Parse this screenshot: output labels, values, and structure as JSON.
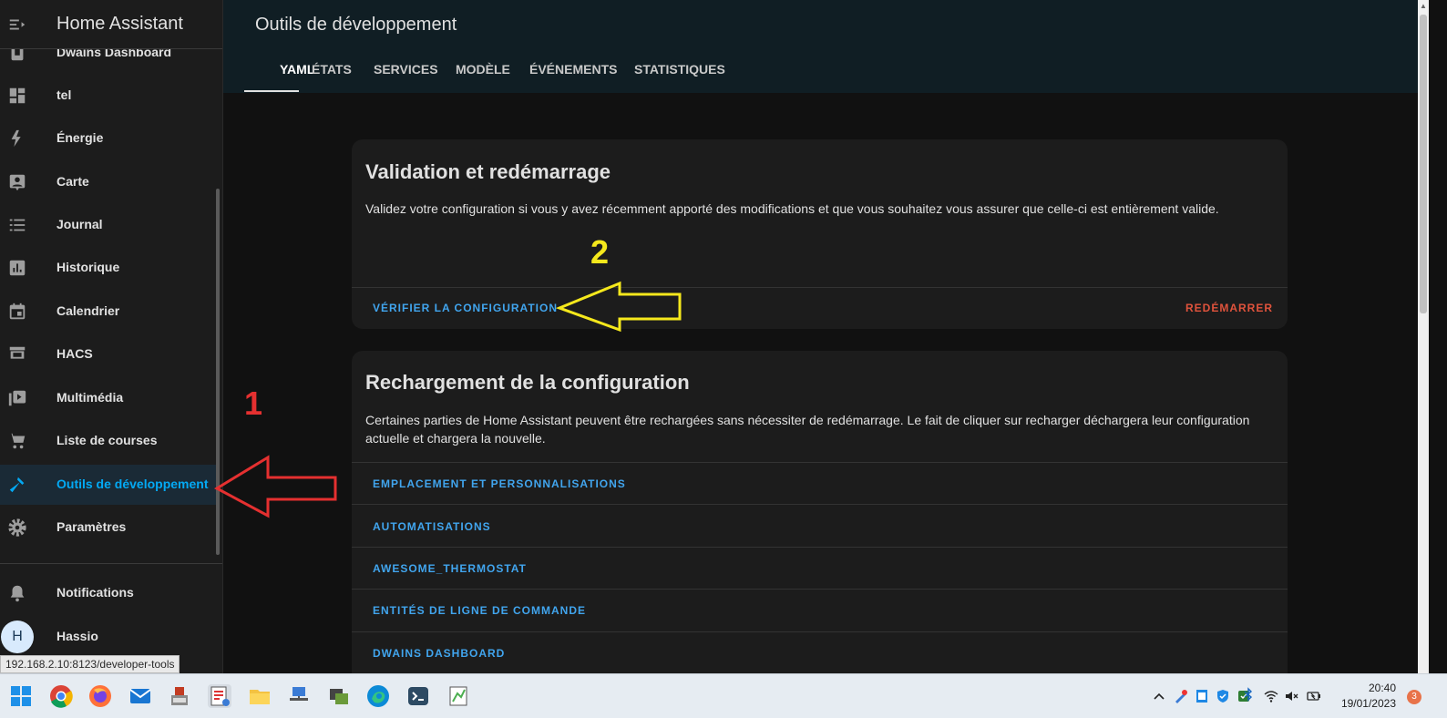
{
  "sidebar": {
    "title": "Home Assistant",
    "items": [
      {
        "label": "Dwains Dashboard",
        "icon": "dashboard-icon"
      },
      {
        "label": "tel",
        "icon": "view-dashboard-icon"
      },
      {
        "label": "Énergie",
        "icon": "lightning-icon"
      },
      {
        "label": "Carte",
        "icon": "map-account-icon"
      },
      {
        "label": "Journal",
        "icon": "list-icon"
      },
      {
        "label": "Historique",
        "icon": "chart-box-icon"
      },
      {
        "label": "Calendrier",
        "icon": "calendar-icon"
      },
      {
        "label": "HACS",
        "icon": "hacs-store-icon"
      },
      {
        "label": "Multimédia",
        "icon": "play-box-multiple-icon"
      },
      {
        "label": "Liste de courses",
        "icon": "cart-icon"
      },
      {
        "label": "Outils de développement",
        "icon": "hammer-icon"
      },
      {
        "label": "Paramètres",
        "icon": "cog-icon"
      }
    ],
    "notifications_label": "Notifications",
    "user_name": "Hassio",
    "user_initial": "H",
    "url_tooltip": "192.168.2.10:8123/developer-tools"
  },
  "header": {
    "title": "Outils de développement",
    "tabs": [
      "YAML",
      "ÉTATS",
      "SERVICES",
      "MODÈLE",
      "ÉVÉNEMENTS",
      "STATISTIQUES"
    ],
    "active_tab": "YAML"
  },
  "validation_card": {
    "title": "Validation et redémarrage",
    "description": "Validez votre configuration si vous y avez récemment apporté des modifications et que vous souhaitez vous assurer que celle-ci est entièrement valide.",
    "check_button": "VÉRIFIER LA CONFIGURATION",
    "restart_button": "REDÉMARRER"
  },
  "reload_card": {
    "title": "Rechargement de la configuration",
    "description": "Certaines parties de Home Assistant peuvent être rechargées sans nécessiter de redémarrage. Le fait de cliquer sur recharger déchargera leur configuration actuelle et chargera la nouvelle.",
    "items": [
      "EMPLACEMENT ET PERSONNALISATIONS",
      "AUTOMATISATIONS",
      "AWESOME_THERMOSTAT",
      "ENTITÉS DE LIGNE DE COMMANDE",
      "DWAINS DASHBOARD"
    ]
  },
  "annotations": {
    "label_1": "1",
    "label_2": "2",
    "color_1": "#e53030",
    "color_2": "#f5e81c"
  },
  "taskbar": {
    "apps": [
      "windows-start-icon",
      "chrome-icon",
      "firefox-icon",
      "mail-icon",
      "installer-icon",
      "snipping-tool-icon",
      "file-explorer-icon",
      "network-app-icon",
      "vm-app-icon",
      "edge-icon",
      "terminal-app-icon",
      "notepad-plus-icon"
    ],
    "time": "20:40",
    "date": "19/01/2023",
    "notification_count": "3"
  },
  "colors": {
    "accent": "#03a9f4",
    "sidebar_bg": "#1c1c1c",
    "header_bg": "#101e24",
    "card_bg": "#1c1c1c",
    "restart_red": "#e0533c"
  }
}
